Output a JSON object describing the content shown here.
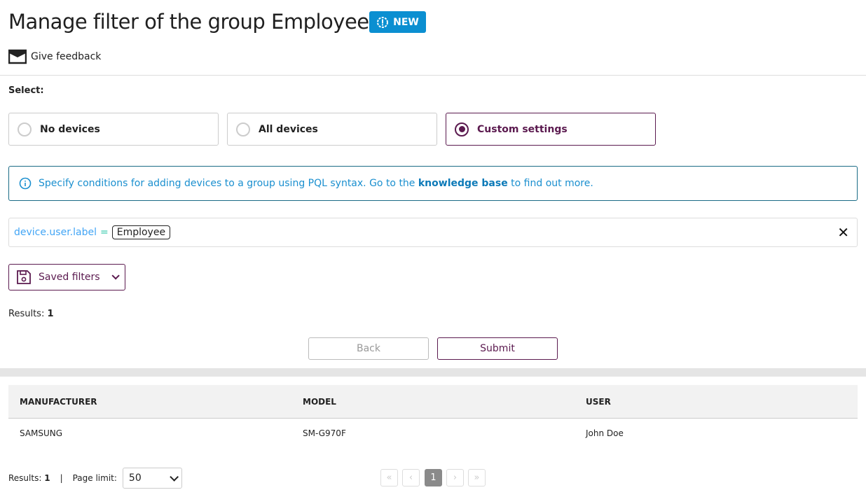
{
  "header": {
    "title": "Manage filter of the group Employee",
    "badge": "NEW",
    "feedback": "Give feedback"
  },
  "select": {
    "label": "Select:",
    "options": [
      {
        "label": "No devices",
        "selected": false
      },
      {
        "label": "All devices",
        "selected": false
      },
      {
        "label": "Custom settings",
        "selected": true
      }
    ]
  },
  "info": {
    "pre": "Specify conditions for adding devices to a group using PQL syntax. Go to the ",
    "link": "knowledge base",
    "post": " to find out more."
  },
  "query": {
    "key": "device.user.label",
    "op": "=",
    "value": "Employee"
  },
  "saved_filters": "Saved filters",
  "results": {
    "label": "Results:",
    "count": "1"
  },
  "buttons": {
    "back": "Back",
    "submit": "Submit"
  },
  "table": {
    "headers": [
      "MANUFACTURER",
      "MODEL",
      "USER"
    ],
    "rows": [
      [
        "SAMSUNG",
        "SM-G970F",
        "John Doe"
      ]
    ]
  },
  "footer": {
    "results_label": "Results:",
    "results_count": "1",
    "sep": "|",
    "page_limit_label": "Page limit:",
    "page_limit": "50",
    "pages": {
      "first": "«",
      "prev": "‹",
      "current": "1",
      "next": "›",
      "last": "»"
    }
  },
  "colors": {
    "accent": "#5b1a4f",
    "badge": "#0b8fd1",
    "info": "#1a8fcf"
  }
}
